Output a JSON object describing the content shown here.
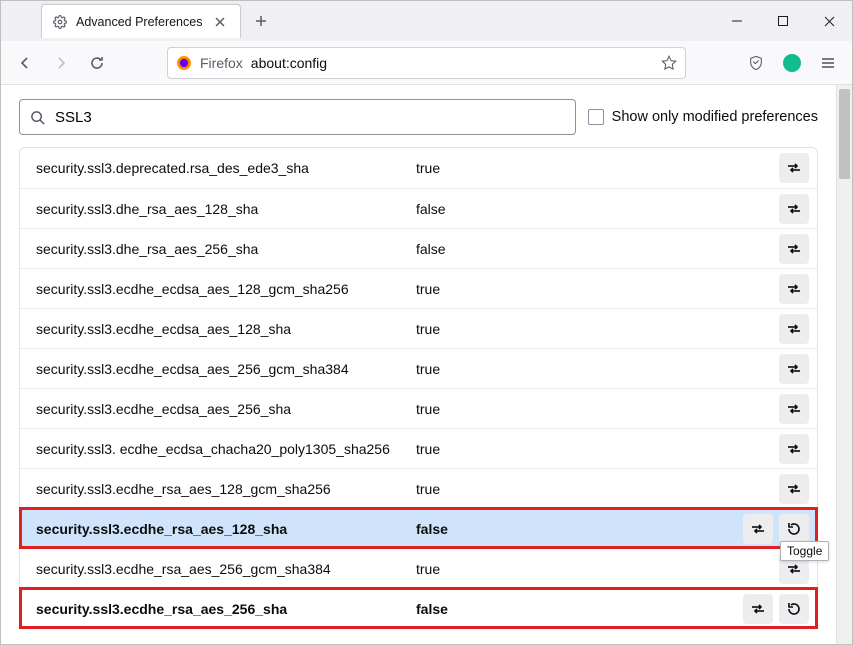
{
  "tab": {
    "title": "Advanced Preferences"
  },
  "url": {
    "prefix": "Firefox",
    "path": "about:config"
  },
  "search": {
    "value": "SSL3"
  },
  "show_modified_label": "Show only modified preferences",
  "tooltip": "Toggle",
  "prefs": [
    {
      "name": "security.ssl3.deprecated.rsa_des_ede3_sha",
      "value": "true",
      "modified": false,
      "selected": false,
      "highlighted": false,
      "reset": false
    },
    {
      "name": "security.ssl3.dhe_rsa_aes_128_sha",
      "value": "false",
      "modified": false,
      "selected": false,
      "highlighted": false,
      "reset": false
    },
    {
      "name": "security.ssl3.dhe_rsa_aes_256_sha",
      "value": "false",
      "modified": false,
      "selected": false,
      "highlighted": false,
      "reset": false
    },
    {
      "name": "security.ssl3.ecdhe_ecdsa_aes_128_gcm_sha256",
      "value": "true",
      "modified": false,
      "selected": false,
      "highlighted": false,
      "reset": false
    },
    {
      "name": "security.ssl3.ecdhe_ecdsa_aes_128_sha",
      "value": "true",
      "modified": false,
      "selected": false,
      "highlighted": false,
      "reset": false
    },
    {
      "name": "security.ssl3.ecdhe_ecdsa_aes_256_gcm_sha384",
      "value": "true",
      "modified": false,
      "selected": false,
      "highlighted": false,
      "reset": false
    },
    {
      "name": "security.ssl3.ecdhe_ecdsa_aes_256_sha",
      "value": "true",
      "modified": false,
      "selected": false,
      "highlighted": false,
      "reset": false
    },
    {
      "name": "security.ssl3.\necdhe_ecdsa_chacha20_poly1305_sha256",
      "value": "true",
      "modified": false,
      "selected": false,
      "highlighted": false,
      "reset": false
    },
    {
      "name": "security.ssl3.ecdhe_rsa_aes_128_gcm_sha256",
      "value": "true",
      "modified": false,
      "selected": false,
      "highlighted": false,
      "reset": false
    },
    {
      "name": "security.ssl3.ecdhe_rsa_aes_128_sha",
      "value": "false",
      "modified": true,
      "selected": true,
      "highlighted": true,
      "reset": true
    },
    {
      "name": "security.ssl3.ecdhe_rsa_aes_256_gcm_sha384",
      "value": "true",
      "modified": false,
      "selected": false,
      "highlighted": false,
      "reset": false
    },
    {
      "name": "security.ssl3.ecdhe_rsa_aes_256_sha",
      "value": "false",
      "modified": true,
      "selected": false,
      "highlighted": true,
      "reset": true
    }
  ]
}
